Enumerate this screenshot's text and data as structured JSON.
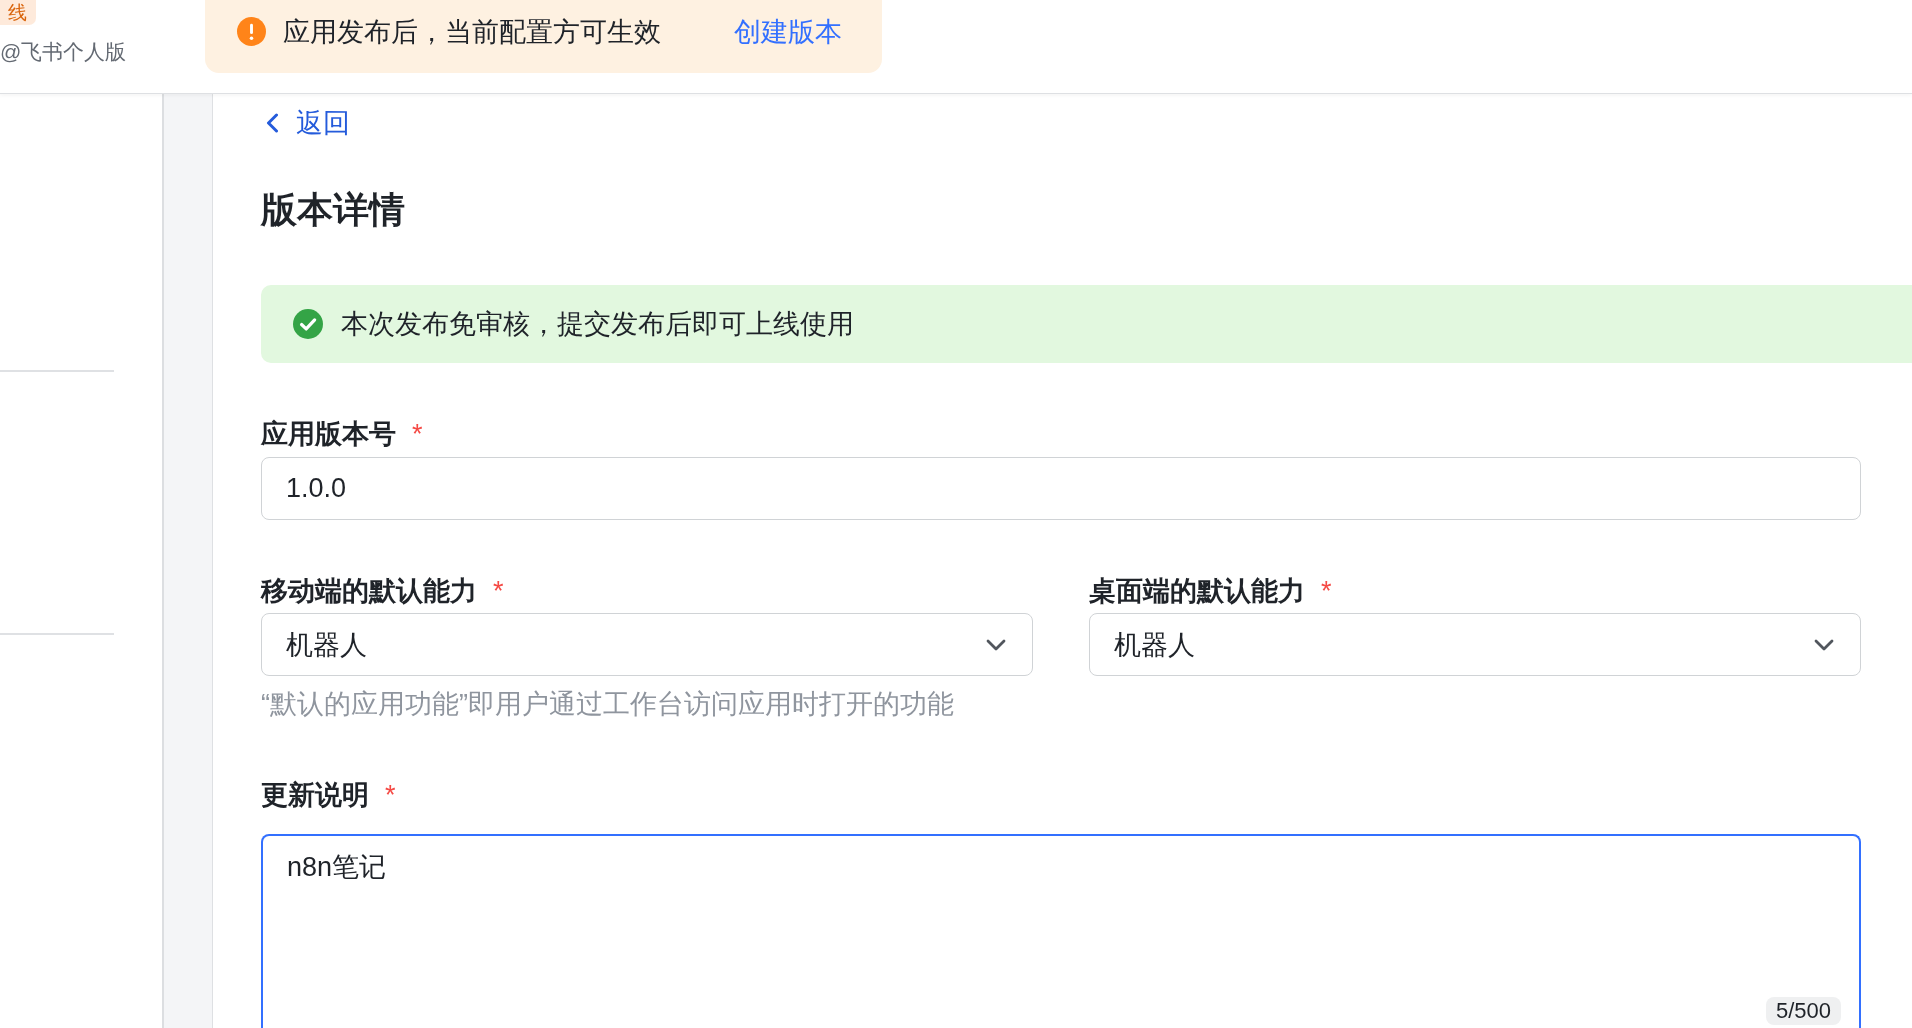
{
  "sidebar": {
    "badge": "线",
    "account": "@飞书个人版"
  },
  "notice": {
    "kind": "warning",
    "message": "应用发布后，当前配置方可生效",
    "action": "创建版本"
  },
  "back_link": "返回",
  "title": "版本详情",
  "alert": {
    "kind": "success",
    "message": "本次发布免审核，提交发布后即可上线使用"
  },
  "fields": [
    {
      "kind": "input",
      "label": "应用版本号",
      "required_mark": "*",
      "value": "1.0.0"
    },
    {
      "kind": "select_row",
      "items": [
        {
          "label": "移动端的默认能力",
          "required_mark": "*",
          "value": "机器人"
        },
        {
          "label": "桌面端的默认能力",
          "required_mark": "*",
          "value": "机器人"
        }
      ],
      "help": "“默认的应用功能”即用户通过工作台访问应用时打开的功能"
    },
    {
      "kind": "textarea",
      "label": "更新说明",
      "required_mark": "*",
      "value": "n8n笔记",
      "focused": true,
      "counter": "5/500"
    }
  ]
}
